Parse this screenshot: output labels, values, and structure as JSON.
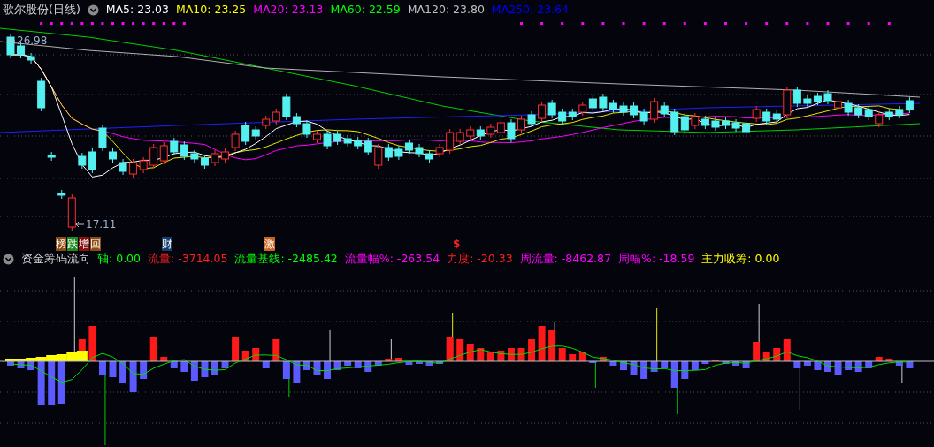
{
  "price_panel": {
    "title": "歌尔股份(日线)",
    "ma_legend": [
      {
        "label": "MA5: 23.03",
        "color": "#ffffff"
      },
      {
        "label": "MA10: 23.25",
        "color": "#ffff00"
      },
      {
        "label": "MA20: 23.13",
        "color": "#ff00ff"
      },
      {
        "label": "MA60: 22.59",
        "color": "#00ff00"
      },
      {
        "label": "MA120: 23.80",
        "color": "#c0c0c0"
      },
      {
        "label": "MA250: 23.64",
        "color": "#0000ff"
      }
    ],
    "high_label": "26.98",
    "low_label": "17.11",
    "markers": [
      {
        "text": "榜",
        "kind": "tag",
        "color": "#8b4a10"
      },
      {
        "text": "跌",
        "kind": "tag",
        "color": "#1d8a1d"
      },
      {
        "text": "增",
        "kind": "tag",
        "color": "#8b1010"
      },
      {
        "text": "回",
        "kind": "tag",
        "color": "#8b4a10"
      },
      {
        "text": "财",
        "kind": "tag",
        "color": "#163e6a"
      },
      {
        "text": "激",
        "kind": "tag",
        "color": "#c8641e"
      },
      {
        "text": "$",
        "kind": "sign",
        "color": "#ff2020"
      }
    ]
  },
  "indicator_panel": {
    "title": "资金筹码流向",
    "readings": [
      {
        "label": "轴: 0.00",
        "color": "#00ff00"
      },
      {
        "label": "流量: -3714.05",
        "color": "#ff2020"
      },
      {
        "label": "流量基线: -2485.42",
        "color": "#00ff00"
      },
      {
        "label": "流量幅%: -263.54",
        "color": "#ff00ff"
      },
      {
        "label": "力度: -20.33",
        "color": "#ff2020"
      },
      {
        "label": "周流量: -8462.87",
        "color": "#ff00ff"
      },
      {
        "label": "周幅%: -18.59",
        "color": "#ff00ff"
      },
      {
        "label": "主力吸筹: 0.00",
        "color": "#ffff00"
      }
    ]
  }
}
